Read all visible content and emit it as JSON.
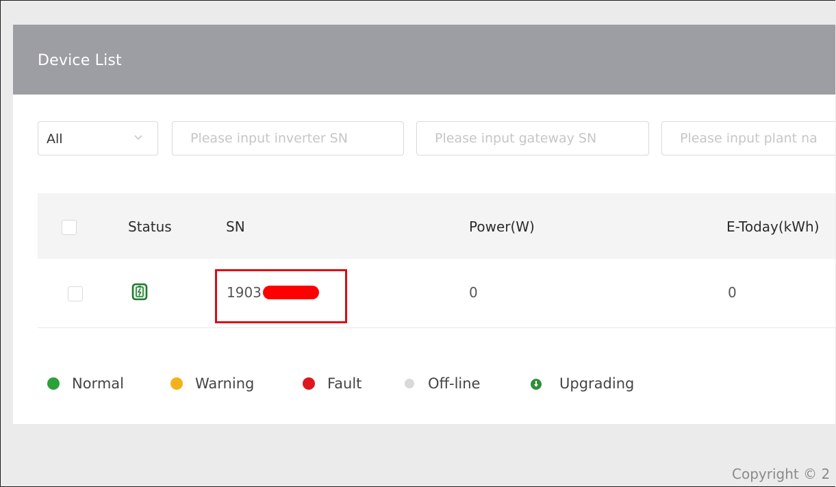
{
  "card": {
    "title": "Device List"
  },
  "filters": {
    "type_select_value": "All",
    "inverter_sn_placeholder": "Please input inverter SN",
    "gateway_sn_placeholder": "Please input gateway SN",
    "plant_name_placeholder": "Please input plant na"
  },
  "table": {
    "headers": {
      "status": "Status",
      "sn": "SN",
      "power": "Power(W)",
      "e_today": "E-Today(kWh)"
    },
    "rows": [
      {
        "status_icon": "battery-charging-icon",
        "sn_visible": "1903",
        "power": "0",
        "e_today": "0"
      }
    ]
  },
  "legend": {
    "items": [
      {
        "label": "Normal",
        "color": "#2aa137"
      },
      {
        "label": "Warning",
        "color": "#f4b21a"
      },
      {
        "label": "Fault",
        "color": "#e0161d"
      },
      {
        "label": "Off-line",
        "color": "#d9d9d9"
      },
      {
        "label": "Upgrading",
        "color": "#2f8f3b"
      }
    ]
  },
  "colors": {
    "header_bg": "#9d9ea3",
    "annotation_red": "#e10613"
  },
  "footer": {
    "copyright": "Copyright © 2"
  }
}
